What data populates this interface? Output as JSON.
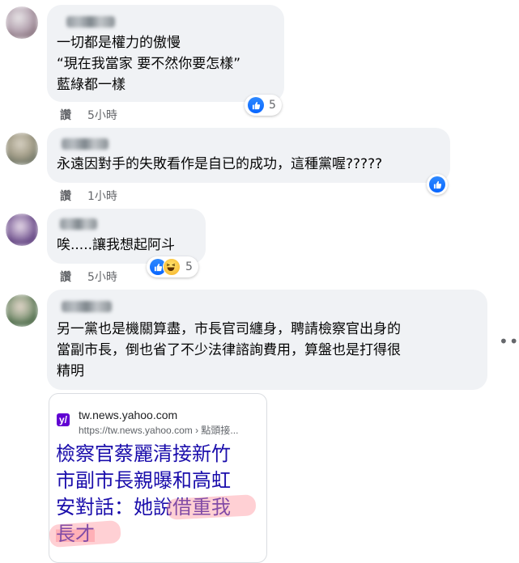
{
  "comments": [
    {
      "lines": [
        "一切都是權力的傲慢",
        "“現在我當家 要不然你要怎樣”",
        "藍綠都一樣"
      ],
      "action": "讚",
      "time": "5小時",
      "reactions": {
        "icons": [
          "like-icon"
        ],
        "count": "5"
      }
    },
    {
      "lines": [
        "永遠因對手的失敗看作是自已的成功，這種黨喔?????"
      ],
      "action": "讚",
      "time": "1小時",
      "reactions": {
        "icons": [
          "like-icon"
        ],
        "count": ""
      }
    },
    {
      "lines": [
        "唉.....讓我想起阿斗"
      ],
      "action": "讚",
      "time": "5小時",
      "reactions": {
        "icons": [
          "like-icon",
          "haha-icon"
        ],
        "count": "5"
      }
    },
    {
      "lines": [
        "另一黨也是機關算盡，市長官司纏身，聘請檢察官出身的",
        "當副市長，倒也省了不少法律諮詢費用，算盤也是打得很",
        "精明"
      ],
      "link_preview": {
        "site": "tw.news.yahoo.com",
        "url": "https://tw.news.yahoo.com › 點頭接...",
        "headline_lines": [
          "檢察官蔡麗清接新竹",
          "市副市長親曝和高虹",
          "安對話：她說借重我",
          "長才"
        ]
      }
    }
  ],
  "more_menu_icon": "more-horizontal-icon",
  "colors": {
    "bubble": "#f0f2f5",
    "meta_text": "#65676b",
    "like_blue": "#0866ff",
    "link_blue": "#1a0dab",
    "highlighter": "#ff96a0"
  }
}
